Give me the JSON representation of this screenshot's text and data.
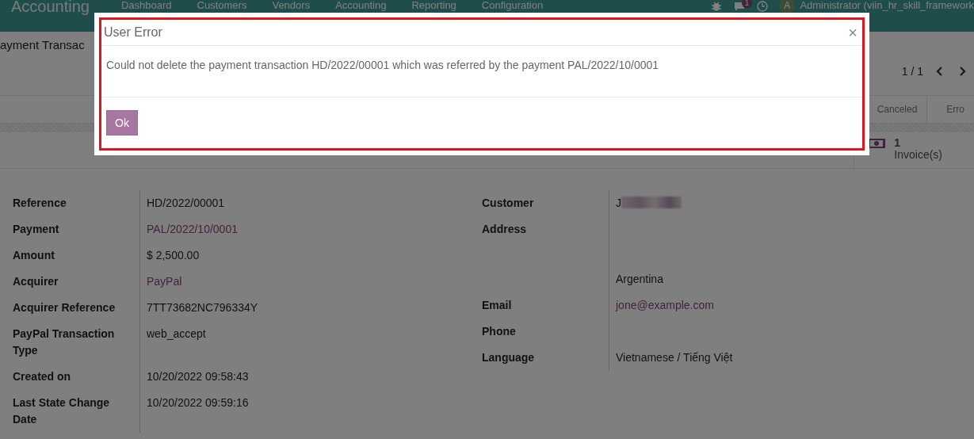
{
  "app": {
    "name": "Accounting",
    "menu": [
      "Dashboard",
      "Customers",
      "Vendors",
      "Accounting",
      "Reporting",
      "Configuration"
    ]
  },
  "systray": {
    "chat_count": "1",
    "avatar_initial": "A",
    "user": "Administrator (viin_hr_skill_framework"
  },
  "breadcrumb": "ayment Transac",
  "pager": "1 / 1",
  "status_bar": [
    "Canceled",
    "Erro"
  ],
  "stat_button": {
    "count": "1",
    "label": "Invoice(s)"
  },
  "fields_left": [
    {
      "label": "Reference",
      "value": "HD/2022/00001",
      "kind": "text"
    },
    {
      "label": "Payment",
      "value": "PAL/2022/10/0001",
      "kind": "link"
    },
    {
      "label": "Amount",
      "value": "$ 2,500.00",
      "kind": "text"
    },
    {
      "label": "Acquirer",
      "value": "PayPal",
      "kind": "link"
    },
    {
      "label": "Acquirer Reference",
      "value": "7TT73682NC796334Y",
      "kind": "text"
    },
    {
      "label": "PayPal Transaction Type",
      "value": "web_accept",
      "kind": "text"
    },
    {
      "label": "Created on",
      "value": "10/20/2022 09:58:43",
      "kind": "text"
    },
    {
      "label": "Last State Change Date",
      "value": "10/20/2022 09:59:16",
      "kind": "text"
    }
  ],
  "fields_right": [
    {
      "label": "Customer",
      "value": "J",
      "kind": "blurred"
    },
    {
      "label": "Address",
      "value": "Argentina",
      "kind": "address"
    },
    {
      "label": "Email",
      "value": "jone@example.com",
      "kind": "link"
    },
    {
      "label": "Phone",
      "kind": "empty"
    },
    {
      "label": "Language",
      "value": "Vietnamese / Tiếng Việt",
      "kind": "text"
    }
  ],
  "dialog": {
    "title": "User Error",
    "close": "×",
    "message": "Could not delete the payment transaction HD/2022/00001 which was referred by the payment PAL/2022/10/0001",
    "button": "Ok",
    "highlighted": true
  }
}
